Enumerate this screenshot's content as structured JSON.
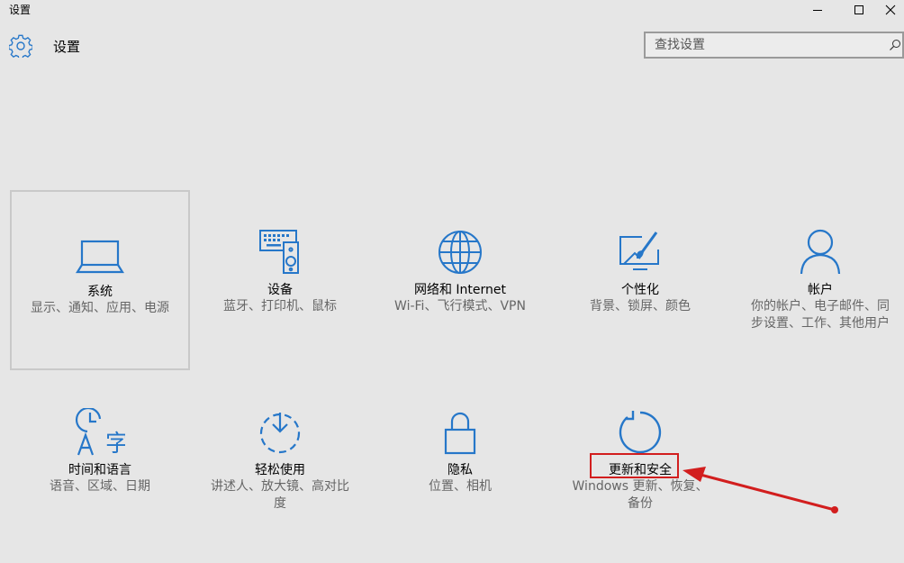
{
  "window": {
    "title": "设置",
    "controls": {
      "minimize": "minimize-icon",
      "maximize": "maximize-icon",
      "close": "close-icon"
    }
  },
  "header": {
    "icon": "gear-icon",
    "title": "设置"
  },
  "search": {
    "placeholder": "查找设置",
    "icon": "search-icon"
  },
  "tiles": [
    {
      "name": "系统",
      "desc": "显示、通知、应用、电源",
      "icon": "laptop-icon"
    },
    {
      "name": "设备",
      "desc": "蓝牙、打印机、鼠标",
      "icon": "devices-icon"
    },
    {
      "name": "网络和 Internet",
      "desc": "Wi-Fi、飞行模式、VPN",
      "icon": "globe-icon"
    },
    {
      "name": "个性化",
      "desc": "背景、锁屏、颜色",
      "icon": "personalization-icon"
    },
    {
      "name": "帐户",
      "desc": "你的帐户、电子邮件、同步设置、工作、其他用户",
      "icon": "person-icon"
    },
    {
      "name": "时间和语言",
      "desc": "语音、区域、日期",
      "icon": "time-language-icon"
    },
    {
      "name": "轻松使用",
      "desc": "讲述人、放大镜、高对比度",
      "icon": "ease-of-access-icon"
    },
    {
      "name": "隐私",
      "desc": "位置、相机",
      "icon": "lock-icon"
    },
    {
      "name": "更新和安全",
      "desc": "Windows 更新、恢复、备份",
      "icon": "update-icon"
    }
  ],
  "colors": {
    "accent": "#2677c9",
    "background": "#e6e6e6",
    "annotation": "#d21e1e"
  }
}
